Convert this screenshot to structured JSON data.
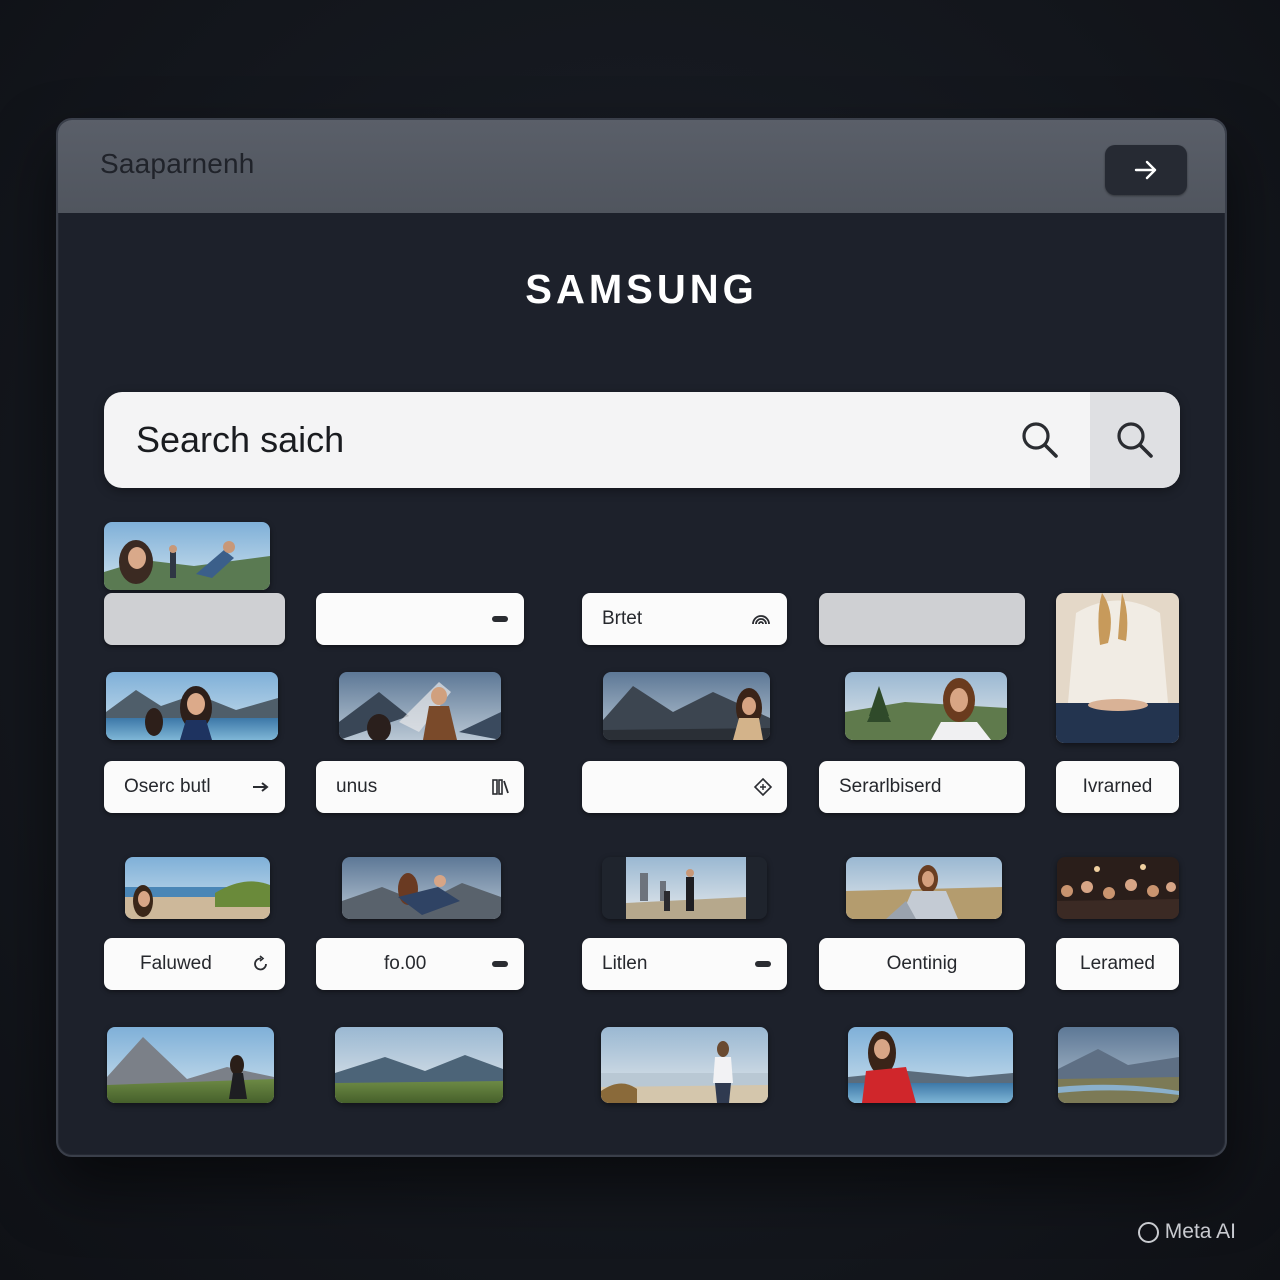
{
  "window": {
    "title": "Saaparnenh"
  },
  "header": {
    "logo": "SAMSUNG"
  },
  "search": {
    "value": "Search saich",
    "icon": "search-icon",
    "button_icon": "search-icon"
  },
  "rows": [
    {
      "pills": [
        {
          "label": "",
          "icon": null,
          "style": "gray"
        },
        {
          "label": "",
          "icon": "dash-icon",
          "style": "white"
        },
        {
          "label": "Brtet",
          "icon": "rainbow-icon",
          "style": "white"
        },
        {
          "label": "",
          "icon": null,
          "style": "gray"
        }
      ]
    },
    {
      "pills": [
        {
          "label": "Oserc butl",
          "icon": "arrow-right-icon"
        },
        {
          "label": "unus",
          "icon": "book-icon"
        },
        {
          "label": "",
          "icon": "diamond-icon"
        },
        {
          "label": "Serarlbiserd",
          "icon": null
        },
        {
          "label": "Ivrarned",
          "icon": null
        }
      ]
    },
    {
      "pills": [
        {
          "label": "Faluwed",
          "icon": "refresh-icon"
        },
        {
          "label": "fo.00",
          "icon": "dash-icon"
        },
        {
          "label": "Litlen",
          "icon": "dash-icon"
        },
        {
          "label": "Oentinig",
          "icon": null
        },
        {
          "label": "Leramed",
          "icon": null
        }
      ]
    }
  ],
  "watermark": "Meta AI",
  "colors": {
    "background": "#14171e",
    "window": "#1d212b",
    "titlebar": "#555a63",
    "pill": "#fbfbfb",
    "pill_gray": "#cfd0d3"
  }
}
